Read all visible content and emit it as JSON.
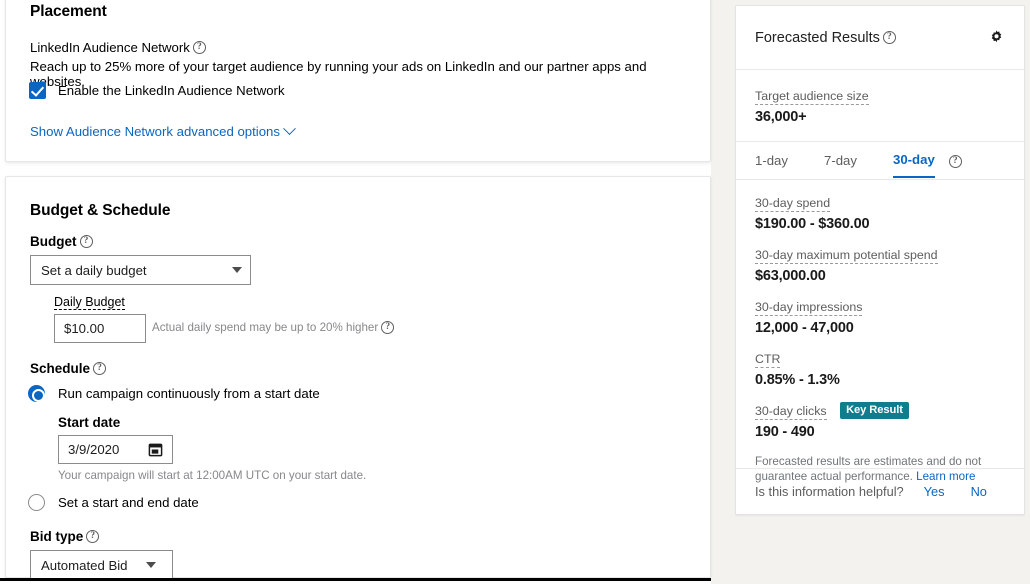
{
  "placement": {
    "section_title": "Placement",
    "network_label": "LinkedIn Audience Network",
    "network_help_icon": "help-icon",
    "network_description": "Reach up to 25% more of your target audience by running your ads on LinkedIn and our partner apps and websites.",
    "enable_checkbox_label": "Enable the LinkedIn Audience Network",
    "enable_checkbox_checked": true,
    "advanced_options_link": "Show Audience Network advanced options",
    "advanced_options_chevron": "chevron-down-icon"
  },
  "budget_schedule": {
    "section_title": "Budget & Schedule",
    "budget_label": "Budget",
    "budget_select_value": "Set a daily budget",
    "budget_select_options": [
      "Set a daily budget"
    ],
    "daily_budget_label": "Daily Budget",
    "daily_budget_value": "$10.00",
    "daily_budget_hint": "Actual daily spend may be up to 20% higher",
    "schedule_label": "Schedule",
    "radio_continuous_label": "Run campaign continuously from a start date",
    "radio_continuous_selected": true,
    "start_date_label": "Start date",
    "start_date_value": "3/9/2020",
    "calendar_icon": "calendar-icon",
    "start_date_hint": "Your campaign will start at 12:00AM UTC on your start date.",
    "radio_range_label": "Set a start and end date",
    "radio_range_selected": false,
    "bid_type_label": "Bid type",
    "bid_type_value": "Automated Bid",
    "bid_type_options": [
      "Automated Bid"
    ]
  },
  "forecast": {
    "title": "Forecasted Results",
    "title_help_icon": "help-icon",
    "settings_icon": "gear-icon",
    "audience": {
      "label": "Target audience size",
      "value": "36,000+"
    },
    "tabs": [
      {
        "label": "1-day",
        "active": false
      },
      {
        "label": "7-day",
        "active": false
      },
      {
        "label": "30-day",
        "active": true
      }
    ],
    "tabs_help_icon": "help-icon",
    "metrics": [
      {
        "label": "30-day spend",
        "value": "$190.00 - $360.00",
        "badge": ""
      },
      {
        "label": "30-day maximum potential spend",
        "value": "$63,000.00",
        "badge": ""
      },
      {
        "label": "30-day impressions",
        "value": "12,000 - 47,000",
        "badge": ""
      },
      {
        "label": "CTR",
        "value": "0.85% - 1.3%",
        "badge": ""
      },
      {
        "label": "30-day clicks",
        "value": "190 - 490",
        "badge": "Key Result"
      }
    ],
    "disclaimer_text": "Forecasted results are estimates and do not guarantee actual performance.",
    "disclaimer_link": "Learn more",
    "footer_question": "Is this information helpful?",
    "footer_yes": "Yes",
    "footer_no": "No"
  },
  "colors": {
    "accent": "#0a66c2",
    "badge": "#0e7d8c",
    "page_bg": "#f3f2ef",
    "card_bg": "#ffffff"
  }
}
